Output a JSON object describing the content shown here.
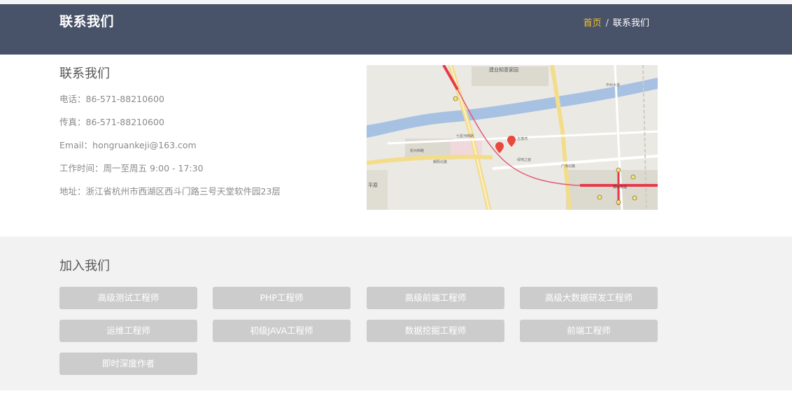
{
  "header": {
    "title": "联系我们",
    "breadcrumb": {
      "home": "首页",
      "separator": "/",
      "current": "联系我们"
    }
  },
  "contact": {
    "heading": "联系我们",
    "lines": [
      "电话：86-571-88210600",
      "传真：86-571-88210600",
      "Email：hongruankeji@163.com",
      "工作时间：周一至周五 9:00 - 17:30",
      "地址：浙江省杭州市西湖区西斗门路三号天堂软件园23层"
    ]
  },
  "map": {
    "labels": [
      "建业知意家园",
      "七星河南路",
      "古荡湾",
      "杭州西路",
      "绿地之窗",
      "广场北路",
      "郑州东站",
      "平原",
      "中州大道",
      "朝阳北路"
    ]
  },
  "join": {
    "heading": "加入我们",
    "jobs": [
      "高级测试工程师",
      "PHP工程师",
      "高级前端工程师",
      "高级大数据研发工程师",
      "运维工程师",
      "初级JAVA工程师",
      "数据挖掘工程师",
      "前端工程师",
      "即时深度作者"
    ]
  },
  "colors": {
    "header_bg": "#485269",
    "breadcrumb_home": "#f2c230",
    "job_button_bg": "#cccccc",
    "join_bg": "#f2f2f2"
  }
}
